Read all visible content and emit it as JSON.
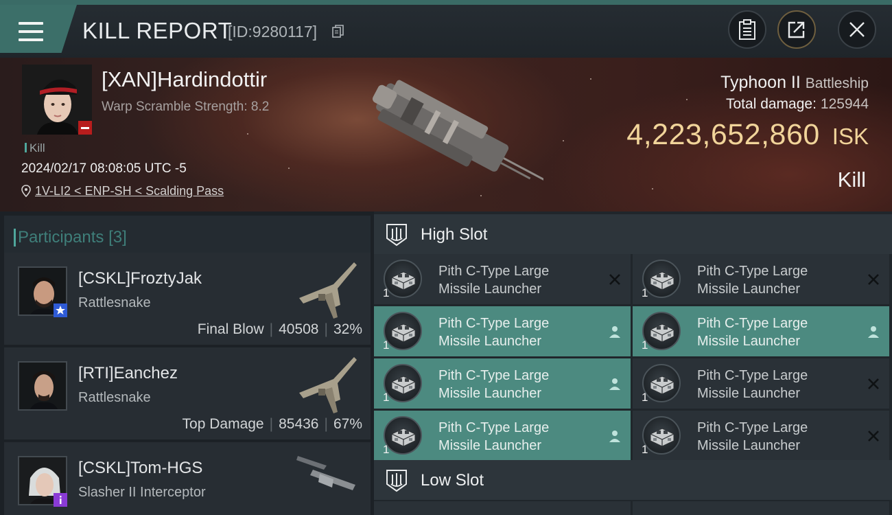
{
  "header": {
    "title": "KILL REPORT",
    "report_id": "[ID:9280117]"
  },
  "victim": {
    "name": "[XAN]Hardindottir",
    "warp_scramble": "Warp Scramble Strength: 8.2",
    "tag": "Kill",
    "timestamp": "2024/02/17 08:08:05 UTC -5",
    "location": "1V-LI2 < ENP-SH < Scalding Pass",
    "ship_name": "Typhoon II",
    "ship_class": "Battleship",
    "total_damage_label": "Total damage:",
    "total_damage": "125944",
    "isk_value": "4,223,652,860",
    "isk_unit": "ISK",
    "result": "Kill"
  },
  "participants": {
    "title": "Participants",
    "count": "[3]",
    "items": [
      {
        "name": "[CSKL]FroztyJak",
        "ship": "Rattlesnake",
        "role": "Final Blow",
        "damage": "40508",
        "percent": "32%",
        "badge": "star-badge",
        "badge_color": "#2f5bd6"
      },
      {
        "name": "[RTI]Eanchez",
        "ship": "Rattlesnake",
        "role": "Top Damage",
        "damage": "85436",
        "percent": "67%",
        "badge": "none",
        "badge_color": ""
      },
      {
        "name": "[CSKL]Tom-HGS",
        "ship": "Slasher II Interceptor",
        "role": "",
        "damage": "",
        "percent": "",
        "badge": "info-badge",
        "badge_color": "#8a3bd6"
      }
    ]
  },
  "fitting": {
    "high_slot_title": "High Slot",
    "low_slot_title": "Low Slot",
    "high_slot_modules": [
      {
        "name_line1": "Pith C-Type Large",
        "name_line2": "Missile Launcher",
        "qty": "1",
        "state": "destroyed"
      },
      {
        "name_line1": "Pith C-Type Large",
        "name_line2": "Missile Launcher",
        "qty": "1",
        "state": "destroyed"
      },
      {
        "name_line1": "Pith C-Type Large",
        "name_line2": "Missile Launcher",
        "qty": "1",
        "state": "dropped"
      },
      {
        "name_line1": "Pith C-Type Large",
        "name_line2": "Missile Launcher",
        "qty": "1",
        "state": "dropped"
      },
      {
        "name_line1": "Pith C-Type Large",
        "name_line2": "Missile Launcher",
        "qty": "1",
        "state": "dropped"
      },
      {
        "name_line1": "Pith C-Type Large",
        "name_line2": "Missile Launcher",
        "qty": "1",
        "state": "destroyed"
      },
      {
        "name_line1": "Pith C-Type Large",
        "name_line2": "Missile Launcher",
        "qty": "1",
        "state": "dropped"
      },
      {
        "name_line1": "Pith C-Type Large",
        "name_line2": "Missile Launcher",
        "qty": "1",
        "state": "destroyed"
      }
    ]
  },
  "colors": {
    "accent_teal": "#4c8a80",
    "isk_gold": "#f1d49a",
    "victim_badge_red": "#b81d1d"
  }
}
